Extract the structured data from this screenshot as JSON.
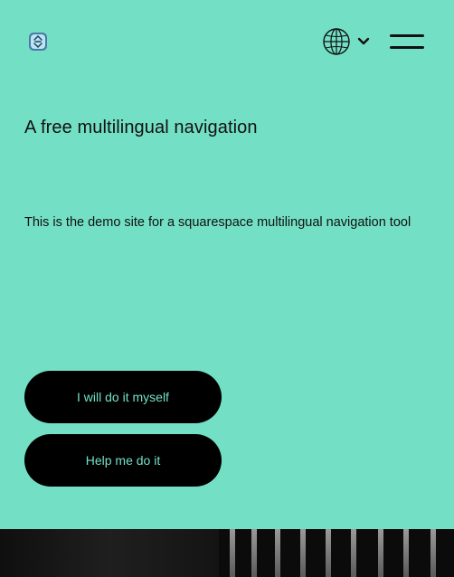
{
  "header": {
    "logo_icon": "squarespace-logo-icon",
    "language_icon": "globe-icon",
    "dropdown_icon": "chevron-down-icon",
    "menu_icon": "hamburger-menu-icon"
  },
  "main": {
    "title": "A free multilingual navigation",
    "description": "This is the demo site for a squarespace multilingual navigation tool"
  },
  "buttons": {
    "primary_label": "I will do it myself",
    "secondary_label": "Help me do it"
  },
  "colors": {
    "background": "#73e0c5",
    "button_bg": "#000000",
    "button_text": "#73e0c5"
  }
}
